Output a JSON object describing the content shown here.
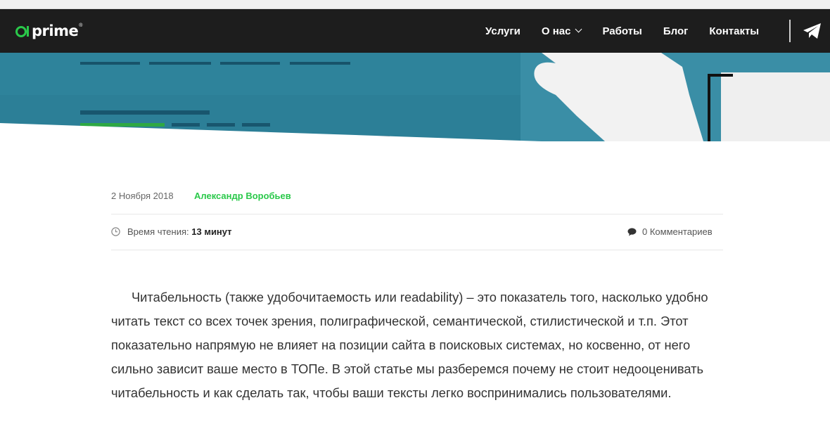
{
  "header": {
    "logo_text": "prime",
    "logo_reg": "®",
    "nav": [
      {
        "label": "Услуги"
      },
      {
        "label": "О нас"
      },
      {
        "label": "Работы"
      },
      {
        "label": "Блог"
      },
      {
        "label": "Контакты"
      }
    ]
  },
  "post": {
    "date": "2 Ноября 2018",
    "author": "Александр Воробьев",
    "reading_time_label": "Время чтения:",
    "reading_time_value": "13 минут",
    "comments": "0 Комментариев",
    "intro": "Читабельность (также удобочитаемость или readability) – это показатель того, насколько удобно читать текст со всех точек зрения, полиграфической, семантической, стилистической и т.п. Этот показательно напрямую не влияет на позиции сайта в поисковых системах, но косвенно, от него сильно зависит ваше место в ТОПе. В этой статье мы разберемся почему не стоит недооценивать читабельность и как сделать так, чтобы ваши тексты легко воспринимались пользователями."
  },
  "colors": {
    "accent": "#2ac94a",
    "header_bg": "#1d1d1d",
    "hero_bg": "#2b7d95"
  }
}
